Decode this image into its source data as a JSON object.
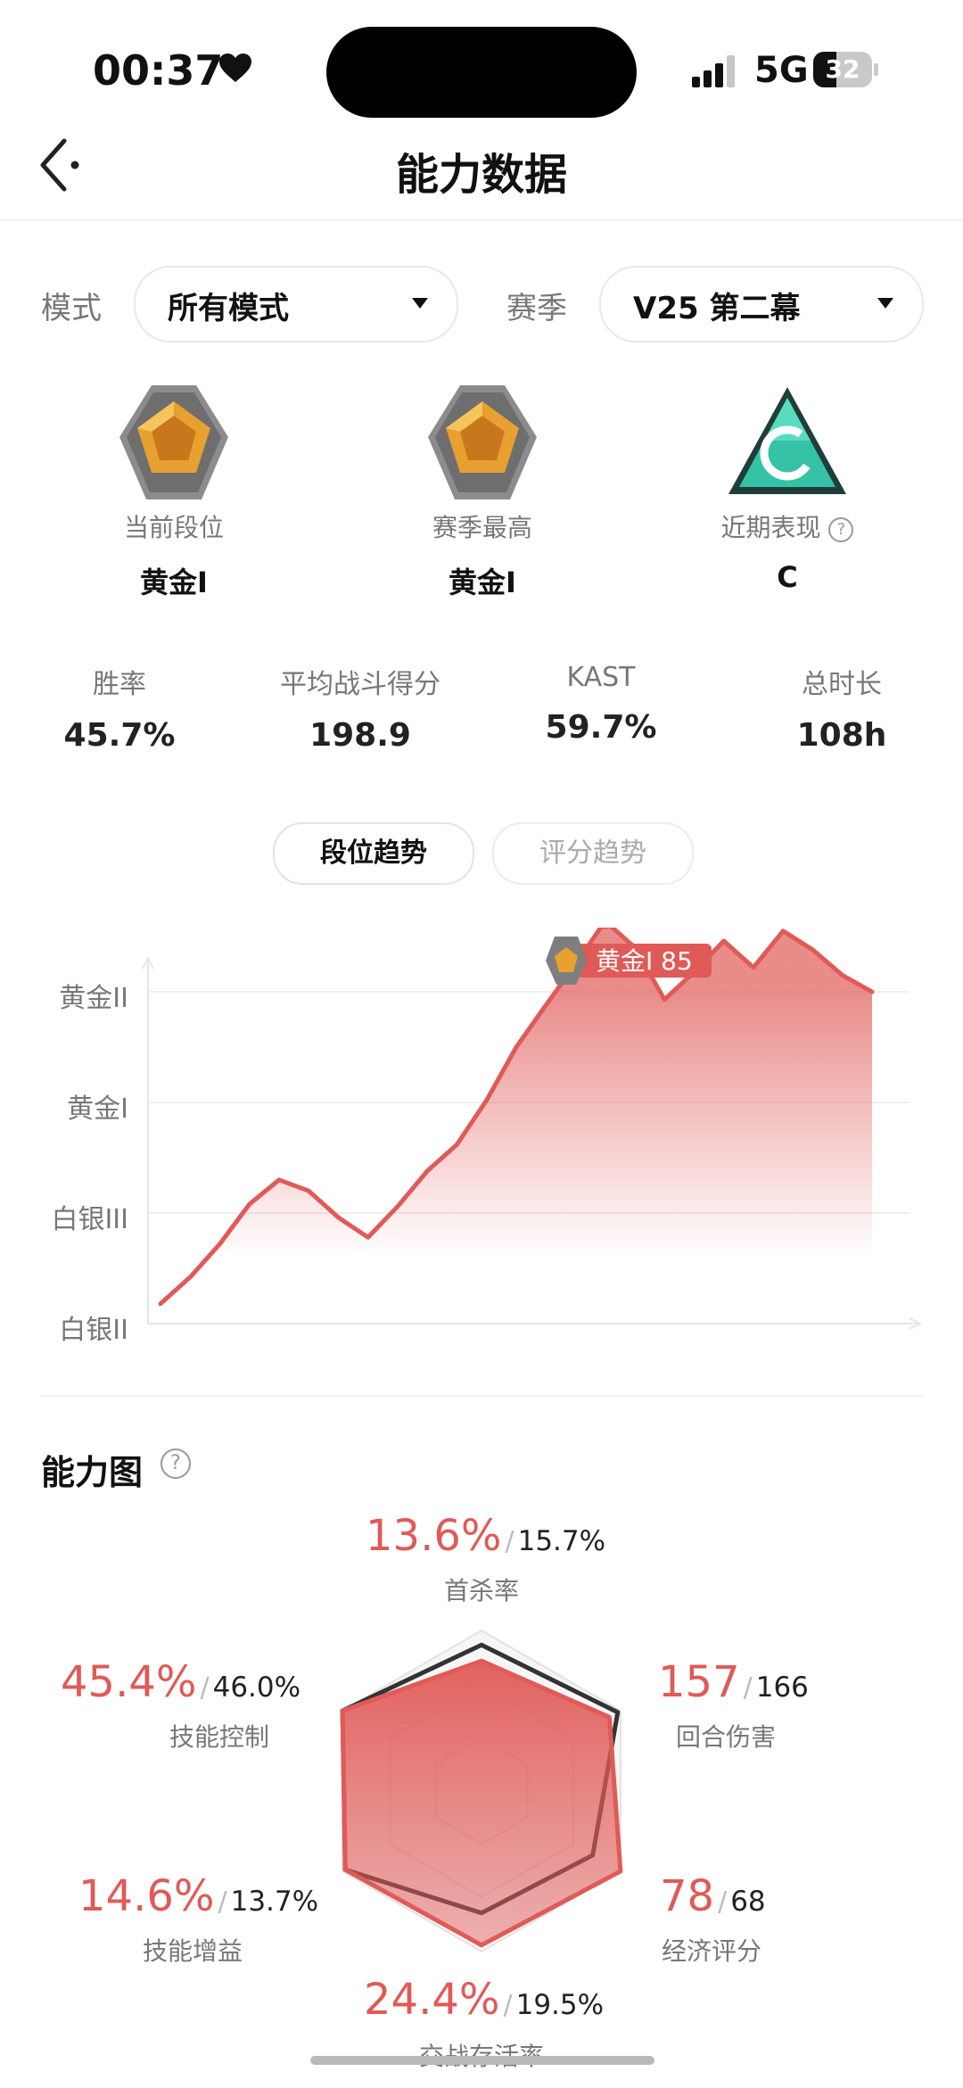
{
  "status_bar": {
    "time": "00:37",
    "network": "5G",
    "battery": "32"
  },
  "header": {
    "title": "能力数据"
  },
  "filters": {
    "mode_label": "模式",
    "mode_value": "所有模式",
    "season_label": "赛季",
    "season_value": "V25 第二幕"
  },
  "ranks": [
    {
      "label": "当前段位",
      "value": "黄金I"
    },
    {
      "label": "赛季最高",
      "value": "黄金I"
    },
    {
      "label": "近期表现",
      "value": "C",
      "help": "?"
    }
  ],
  "stats": [
    {
      "label": "胜率",
      "value": "45.7%"
    },
    {
      "label": "平均战斗得分",
      "value": "198.9"
    },
    {
      "label": "KAST",
      "value": "59.7%"
    },
    {
      "label": "总时长",
      "value": "108h"
    }
  ],
  "tabs": {
    "active": "段位趋势",
    "inactive": "评分趋势"
  },
  "chart_data": {
    "type": "area",
    "y_tiers": [
      "白银II",
      "白银III",
      "黄金I",
      "黄金II"
    ],
    "series": [
      {
        "values": [
          0.18,
          0.42,
          0.72,
          1.08,
          1.3,
          1.2,
          0.96,
          0.78,
          1.06,
          1.38,
          1.62,
          2.02,
          2.5,
          2.88,
          3.25,
          3.64,
          3.4,
          2.93,
          3.18,
          3.46,
          3.22,
          3.55,
          3.38,
          3.15,
          3.0
        ]
      }
    ],
    "annotation": {
      "label": "黄金I 85",
      "point_index": 15
    },
    "grid": true
  },
  "ability": {
    "title": "能力图",
    "help": "?",
    "items": [
      {
        "name": "首杀率",
        "value": "13.6%",
        "avg": "15.7%"
      },
      {
        "name": "回合伤害",
        "value": "157",
        "avg": "166"
      },
      {
        "name": "经济评分",
        "value": "78",
        "avg": "68"
      },
      {
        "name": "交战存活率",
        "value": "24.4%",
        "avg": "19.5%"
      },
      {
        "name": "技能增益",
        "value": "14.6%",
        "avg": "13.7%"
      },
      {
        "name": "技能控制",
        "value": "45.4%",
        "avg": "46.0%"
      }
    ],
    "slash": "/",
    "radar_player": [
      0.81,
      0.92,
      1.0,
      0.96,
      0.98,
      1.0
    ],
    "radar_average": [
      0.91,
      0.98,
      0.8,
      0.76,
      0.98,
      1.0
    ],
    "colors": {
      "accent": "#e05a57",
      "average": "#333333"
    }
  }
}
